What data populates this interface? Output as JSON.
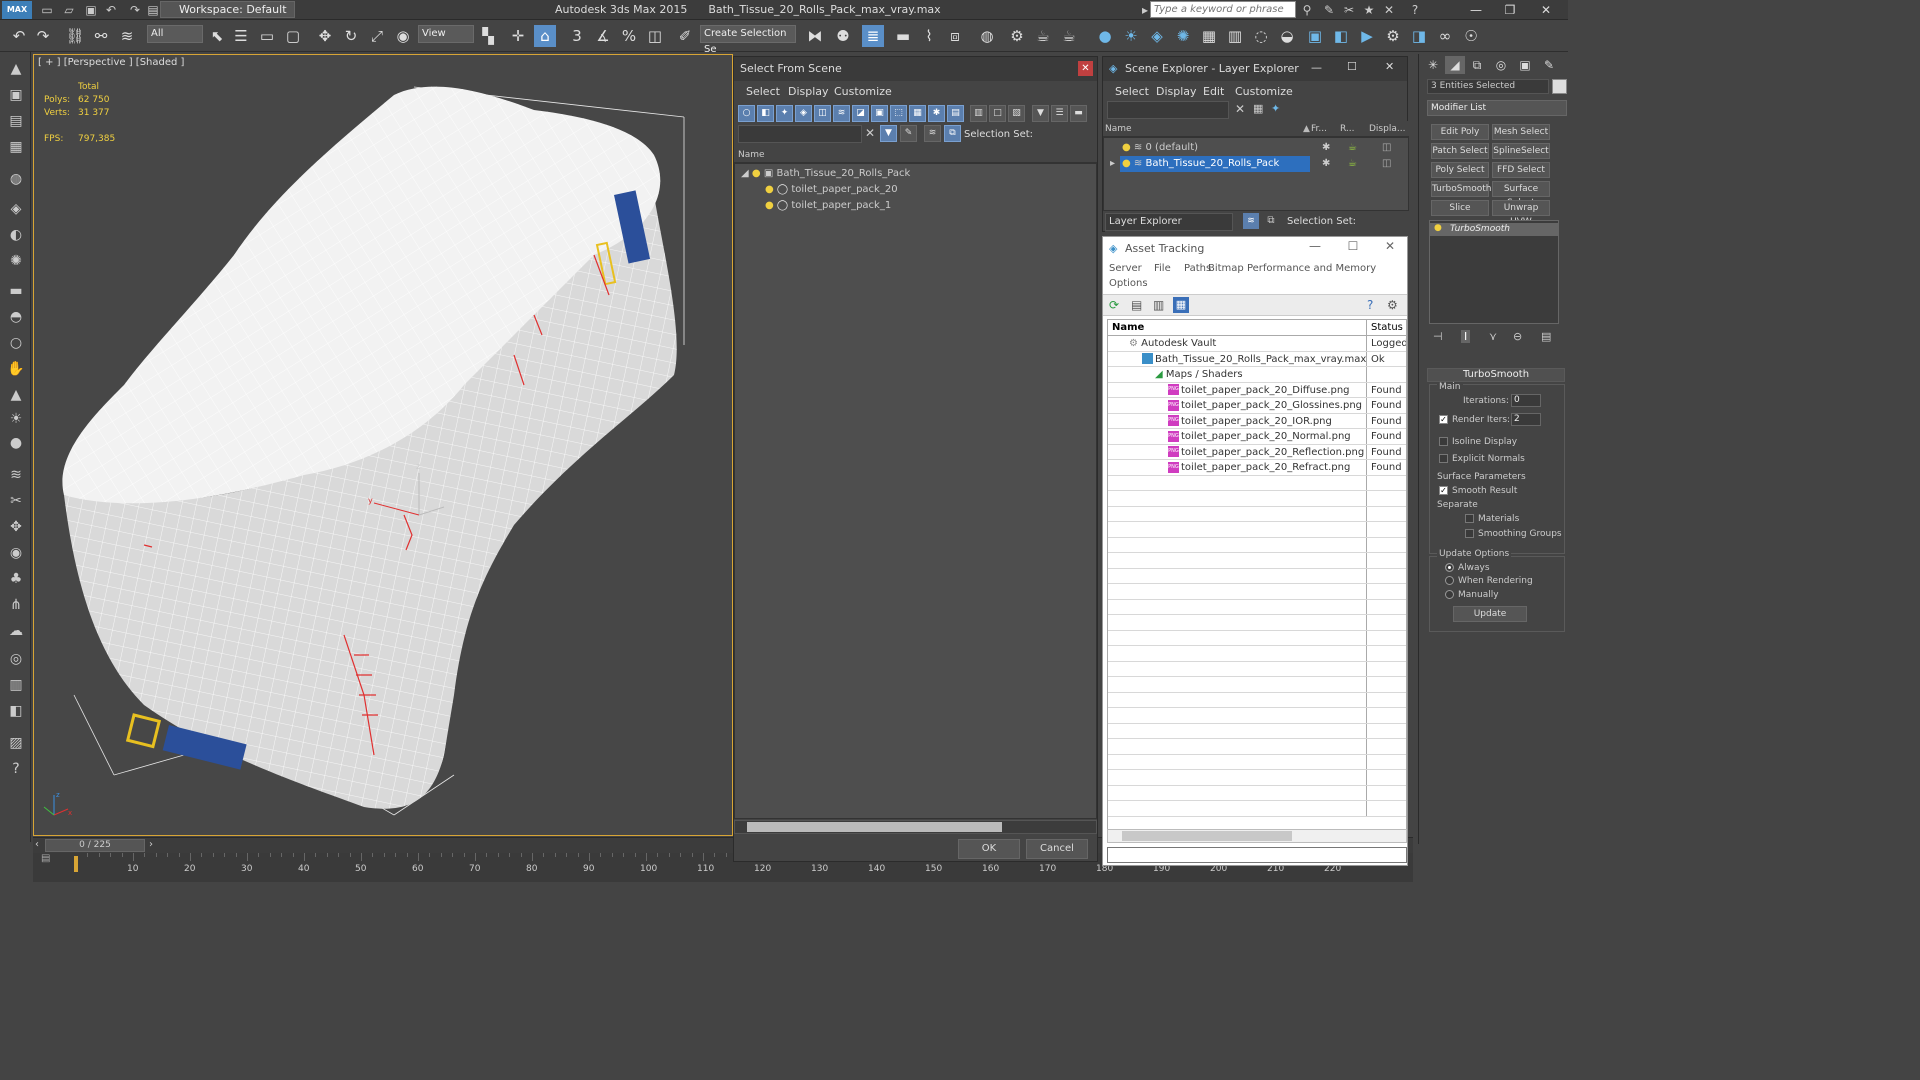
{
  "titlebar": {
    "logo": "MAX",
    "workspace": "Workspace: Default",
    "app_title": "Autodesk 3ds Max  2015",
    "file_title": "Bath_Tissue_20_Rolls_Pack_max_vray.max",
    "search_placeholder": "Type a keyword or phrase"
  },
  "toolbar": {
    "selection_filter": "All",
    "ref_coord": "View",
    "named_selection": "Create Selection Se"
  },
  "viewport": {
    "label": "[ + ] [Perspective ] [Shaded ]",
    "stats_header": "Total",
    "polys_label": "Polys:",
    "polys_value": "62 750",
    "verts_label": "Verts:",
    "verts_value": "31 377",
    "fps_label": "FPS:",
    "fps_value": "797,385",
    "accent_color": "#d8a535",
    "axis_x": "x",
    "axis_y": "y",
    "axis_z": "z"
  },
  "timeline": {
    "frame": "0 / 225",
    "ticks": [
      "10",
      "20",
      "30",
      "40",
      "50",
      "60",
      "70",
      "80",
      "90",
      "100",
      "110",
      "120",
      "130",
      "140",
      "150",
      "160",
      "170",
      "180",
      "190",
      "200",
      "210",
      "220"
    ]
  },
  "select_from_scene": {
    "title": "Select From Scene",
    "menu": [
      "Select",
      "Display",
      "Customize"
    ],
    "selection_set_label": "Selection Set:",
    "column_name": "Name",
    "items": [
      {
        "name": "Bath_Tissue_20_Rolls_Pack",
        "level": 0
      },
      {
        "name": "toilet_paper_pack_20",
        "level": 1
      },
      {
        "name": "toilet_paper_pack_1",
        "level": 1
      }
    ],
    "ok": "OK",
    "cancel": "Cancel"
  },
  "scene_explorer": {
    "title": "Scene Explorer - Layer Explorer",
    "menu": [
      "Select",
      "Display",
      "Edit",
      "Customize"
    ],
    "columns": [
      "Name",
      "Fr...",
      "R...",
      "Displa..."
    ],
    "layers": [
      {
        "name": "0 (default)",
        "selected": false
      },
      {
        "name": "Bath_Tissue_20_Rolls_Pack",
        "selected": true
      }
    ],
    "footer_dropdown": "Layer Explorer",
    "selection_set_label": "Selection Set:"
  },
  "asset_tracking": {
    "title": "Asset Tracking",
    "menu": [
      "Server",
      "File",
      "Paths",
      "Bitmap Performance and Memory",
      "Options"
    ],
    "col_name": "Name",
    "col_status": "Status",
    "rows": [
      {
        "name": "Autodesk Vault",
        "status": "Logged",
        "indent": 1,
        "icon": "vault"
      },
      {
        "name": "Bath_Tissue_20_Rolls_Pack_max_vray.max",
        "status": "Ok",
        "indent": 2,
        "icon": "max"
      },
      {
        "name": "Maps / Shaders",
        "status": "",
        "indent": 3,
        "icon": "folder"
      },
      {
        "name": "toilet_paper_pack_20_Diffuse.png",
        "status": "Found",
        "indent": 4,
        "icon": "png"
      },
      {
        "name": "toilet_paper_pack_20_Glossines.png",
        "status": "Found",
        "indent": 4,
        "icon": "png"
      },
      {
        "name": "toilet_paper_pack_20_IOR.png",
        "status": "Found",
        "indent": 4,
        "icon": "png"
      },
      {
        "name": "toilet_paper_pack_20_Normal.png",
        "status": "Found",
        "indent": 4,
        "icon": "png"
      },
      {
        "name": "toilet_paper_pack_20_Reflection.png",
        "status": "Found",
        "indent": 4,
        "icon": "png"
      },
      {
        "name": "toilet_paper_pack_20_Refract.png",
        "status": "Found",
        "indent": 4,
        "icon": "png"
      }
    ],
    "png_badge": "PNG"
  },
  "command_panel": {
    "entities": "3 Entities Selected",
    "modifier_list": "Modifier List",
    "buttons": [
      "Edit Poly",
      "Mesh Select",
      "Patch Select",
      "SplineSelect",
      "Poly Select",
      "FFD Select",
      "TurboSmooth",
      "Surface Select",
      "Slice",
      "Unwrap UVW"
    ],
    "stack_item": "TurboSmooth",
    "rollout_title": "TurboSmooth",
    "main_label": "Main",
    "iterations_label": "Iterations:",
    "iterations_value": "0",
    "render_iters_label": "Render Iters:",
    "render_iters_value": "2",
    "isoline": "Isoline Display",
    "explicit_normals": "Explicit Normals",
    "surface_params": "Surface Parameters",
    "smooth_result": "Smooth Result",
    "separate": "Separate",
    "materials": "Materials",
    "smoothing_groups": "Smoothing Groups",
    "update_options": "Update Options",
    "always": "Always",
    "when_rendering": "When Rendering",
    "manually": "Manually",
    "update_button": "Update"
  }
}
